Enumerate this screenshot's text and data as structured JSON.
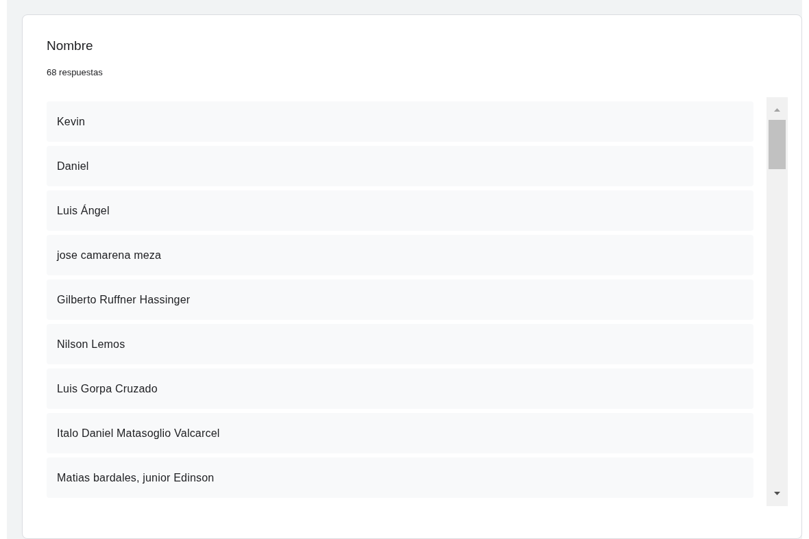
{
  "question": {
    "title": "Nombre",
    "count": "68 respuestas"
  },
  "responses": [
    "Kevin",
    "Daniel",
    "Luis Ángel",
    "jose camarena meza",
    "Gilberto Ruffner Hassinger",
    "Nilson Lemos",
    "Luis Gorpa Cruzado",
    "Italo Daniel Matasoglio Valcarcel",
    "Matias bardales, junior Edinson"
  ]
}
